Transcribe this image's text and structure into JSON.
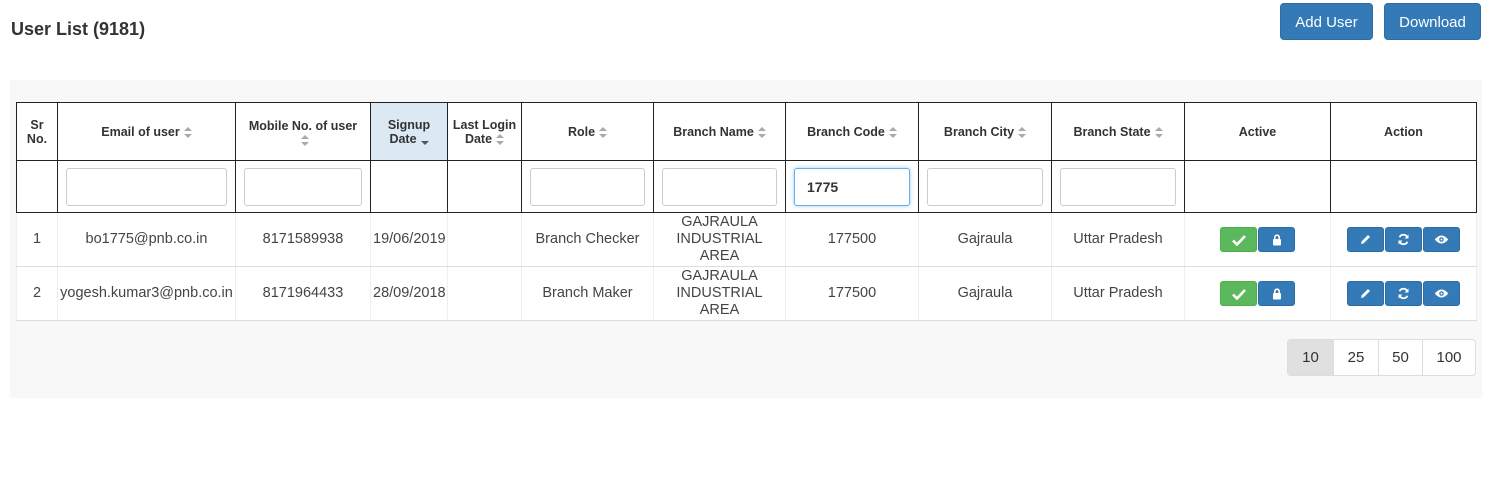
{
  "header": {
    "title": "User List (9181)",
    "add_user_label": "Add User",
    "download_label": "Download"
  },
  "columns": [
    "Sr No.",
    "Email of user",
    "Mobile No. of user",
    "Signup Date",
    "Last Login Date",
    "Role",
    "Branch Name",
    "Branch Code",
    "Branch City",
    "Branch State",
    "Active",
    "Action"
  ],
  "filters": {
    "branch_code": "1775"
  },
  "rows": [
    {
      "sr": "1",
      "email": "bo1775@pnb.co.in",
      "mobile": "8171589938",
      "signup": "19/06/2019",
      "last_login": "",
      "role": "Branch Checker",
      "branch_name": "GAJRAULA INDUSTRIAL AREA",
      "branch_code": "177500",
      "city": "Gajraula",
      "state": "Uttar Pradesh"
    },
    {
      "sr": "2",
      "email": "yogesh.kumar3@pnb.co.in",
      "mobile": "8171964433",
      "signup": "28/09/2018",
      "last_login": "",
      "role": "Branch Maker",
      "branch_name": "GAJRAULA INDUSTRIAL AREA",
      "branch_code": "177500",
      "city": "Gajraula",
      "state": "Uttar Pradesh"
    }
  ],
  "icons": {
    "active": [
      "check-icon",
      "lock-icon"
    ],
    "action": [
      "pencil-icon",
      "refresh-icon",
      "eye-icon"
    ]
  },
  "page_sizes": [
    "10",
    "25",
    "50",
    "100"
  ],
  "selected_page_size": "10",
  "colors": {
    "primary": "#337ab7",
    "success": "#5cb85c",
    "sorted_header": "#dbe9f4"
  }
}
